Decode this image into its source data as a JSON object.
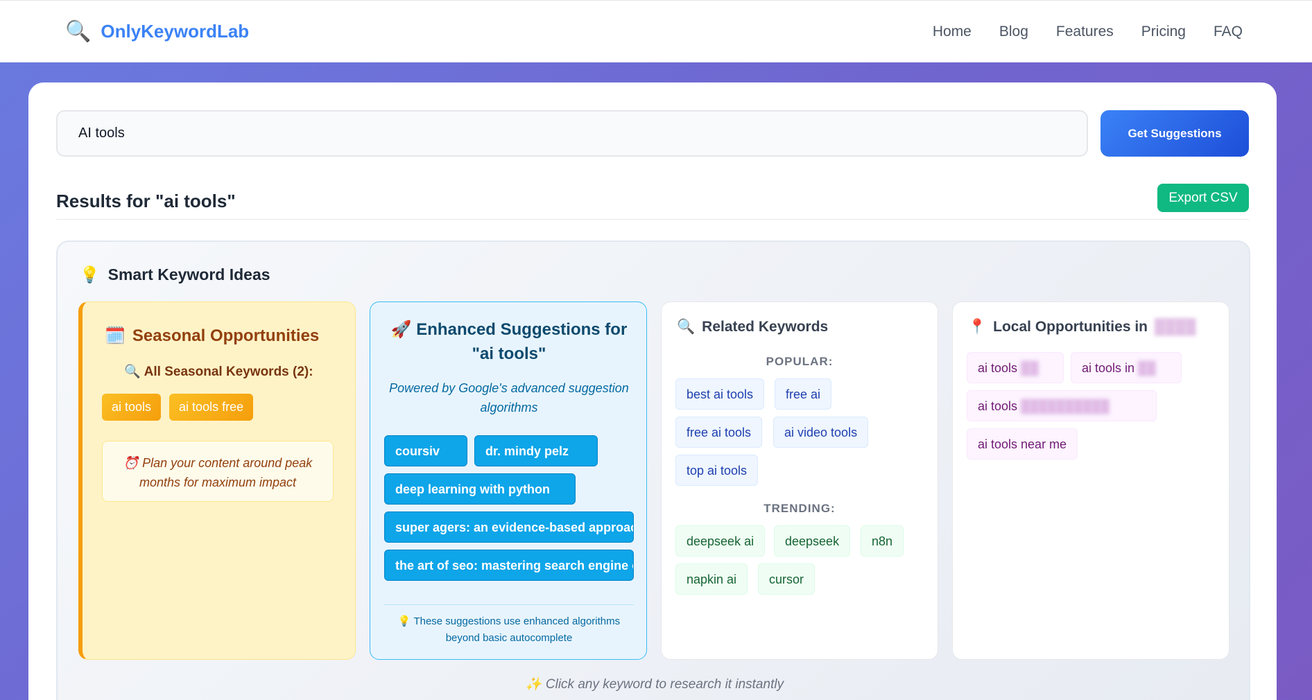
{
  "header": {
    "brand_icon": "🔍",
    "brand_name": "OnlyKeywordLab",
    "nav": [
      "Home",
      "Blog",
      "Features",
      "Pricing",
      "FAQ"
    ]
  },
  "search": {
    "value": "AI tools",
    "button_label": "Get Suggestions"
  },
  "results": {
    "title": "Results for \"ai tools\"",
    "export_label": "Export CSV"
  },
  "ideas": {
    "icon": "💡",
    "title": "Smart Keyword Ideas",
    "footer_icon": "✨",
    "footer": "Click any keyword to research it instantly"
  },
  "seasonal": {
    "icon": "🗓️",
    "title": "Seasonal Opportunities",
    "sub_icon": "🔍",
    "subtitle": "All Seasonal Keywords (2):",
    "tags": [
      "ai tools",
      "ai tools free"
    ],
    "note_icon": "⏰",
    "note": "Plan your content around peak months for maximum impact"
  },
  "enhanced": {
    "icon": "🚀",
    "title": "Enhanced Suggestions for \"ai tools\"",
    "subtitle": "Powered by Google's advanced suggestion algorithms",
    "tags": [
      "coursiv",
      "dr. mindy pelz",
      "deep learning with python",
      "super agers: an evidence-based approac",
      "the art of seo: mastering search engine o"
    ],
    "foot_icon": "💡",
    "foot": "These suggestions use enhanced algorithms beyond basic autocomplete"
  },
  "related": {
    "icon": "🔍",
    "title": "Related Keywords",
    "popular_label": "POPULAR:",
    "popular": [
      "best ai tools",
      "free ai",
      "free ai tools",
      "ai video tools",
      "top ai tools"
    ],
    "trending_label": "TRENDING:",
    "trending": [
      "deepseek ai",
      "deepseek",
      "n8n",
      "napkin ai",
      "cursor"
    ]
  },
  "local": {
    "icon": "📍",
    "title": "Local Opportunities in",
    "tags": [
      "ai tools",
      "ai tools in",
      "ai tools",
      "ai tools near me"
    ]
  },
  "colors": {
    "brand": "#3b82f6",
    "primary_button": "#1d4ed8",
    "export_button": "#10b981",
    "seasonal_accent": "#f59e0b",
    "enhanced_accent": "#0ea5e9"
  }
}
